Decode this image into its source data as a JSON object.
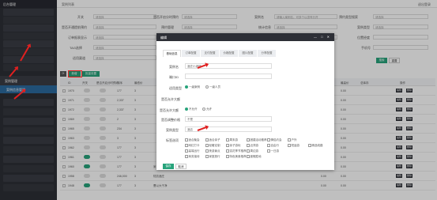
{
  "sidebar": {
    "logo": "后台管理",
    "active_item": "案例管理",
    "sub_item": "案例信息管理"
  },
  "topbar": {
    "title": "案例列表",
    "right": "退出登录"
  },
  "filters": {
    "row1": [
      "开关",
      "是否开启分时预约",
      "案例名",
      "预约类型搜索"
    ],
    "row2": [
      "是否开通提前预约",
      "预约管理",
      "统计信息",
      "案例类型"
    ],
    "row3": [
      "订单报表显示",
      "开放设置",
      "日期",
      "位置经度"
    ],
    "row4": [
      "TAG选择",
      "",
      "",
      "手机号"
    ],
    "row5": [
      "适用渠道",
      "",
      "",
      ""
    ],
    "select_placeholder": "请选择",
    "input_placeholder": "请输入案例名，可多个以逗号分开",
    "search_label": "搜索",
    "reset_label": "重置"
  },
  "toolbar": {
    "refresh": "",
    "add": "新增",
    "batch": "批量设置"
  },
  "table": {
    "headers": [
      "ID",
      "开关",
      "是否开启分时预约",
      "排序",
      "最低价",
      "案例名",
      "案例分类",
      "人均消费",
      "商户数",
      "营业时间",
      "状态",
      "最低价",
      "最高价",
      "总库存",
      "操作"
    ],
    "rows": [
      {
        "id": "1970",
        "sort": "177",
        "price": "3",
        "v1": "0.00",
        "v2": "0.00",
        "on": false
      },
      {
        "id": "1971",
        "sort": "2,337",
        "price": "3",
        "v1": "0.00",
        "v2": "0.00",
        "on": false
      },
      {
        "id": "1972",
        "sort": "2,337",
        "price": "3",
        "v1": "0.00",
        "v2": "0.00",
        "on": false
      },
      {
        "id": "1969",
        "sort": "2",
        "price": "3",
        "v1": "0.00",
        "v2": "0.00",
        "on": false
      },
      {
        "id": "1965",
        "sort": "234",
        "price": "3",
        "v1": "99999.00",
        "v2": "0.00",
        "on": false
      },
      {
        "id": "1963",
        "sort": "3",
        "price": "3",
        "v1": "0.00",
        "v2": "0.00",
        "on": false
      },
      {
        "id": "1962",
        "sort": "177",
        "price": "3",
        "v1": "99999.00",
        "v2": "0.00",
        "on": false
      },
      {
        "id": "1961",
        "sort": "177",
        "price": "3",
        "v1": "0.00",
        "v2": "0.00",
        "on": true
      },
      {
        "id": "1960",
        "sort": "177",
        "price": "3",
        "name": "米丁酒小农庄园",
        "v1": "0.00",
        "v2": "0.00",
        "on": true
      },
      {
        "id": "1958",
        "sort": "246,000",
        "price": "3",
        "name": "陆凯酒庄",
        "v1": "0.00",
        "v2": "0.00",
        "on": false
      },
      {
        "id": "1948",
        "sort": "177",
        "price": "3",
        "name": "曹以大干净",
        "v1": "0.00",
        "v2": "0.00",
        "on": true
      }
    ],
    "actions": [
      "编辑",
      "删除"
    ]
  },
  "modal": {
    "title": "编辑",
    "tabs": [
      "基础信息",
      "订单配置",
      "支付配置",
      "价格配置",
      "图片配置",
      "分享配置"
    ],
    "fields": {
      "name_label": "案例名",
      "name_value": "酒庄小酒馆",
      "port_label": "端口ID",
      "type_label": "适用类型",
      "type_opt1": "一级案例",
      "type_opt2": "一级人员",
      "deploy_label": "是否允许大额",
      "deploy_opt1": "不允许",
      "deploy_opt2": "允许",
      "adjust_label": "是否调整价格",
      "adjust_value": "不是",
      "case_type_label": "案例类型",
      "case_type_value": "酒店",
      "tags_label": "标签选项"
    },
    "tag_options": [
      [
        "适合聚会",
        "适合亲子",
        "周末游",
        "团建活动推荐",
        "情侣约会",
        "户外"
      ],
      [
        "网红打卡",
        "轻奢定制",
        "亲子游玩",
        "近郊游",
        "自由行",
        "短途游",
        "精选线路"
      ],
      [
        "高端出行",
        "夜游景点",
        "赏花季节推荐",
        "周边游",
        "一日游"
      ],
      [
        "商务接待",
        "家庭旅行",
        "特色美食推荐",
        "度假胜地"
      ]
    ],
    "save_label": "保存",
    "cancel_label": "取消"
  },
  "colors": {
    "accent": "#27a37b",
    "sidebar": "#2d2f36",
    "highlight": "#e02020",
    "blue": "#2b6a9e"
  }
}
